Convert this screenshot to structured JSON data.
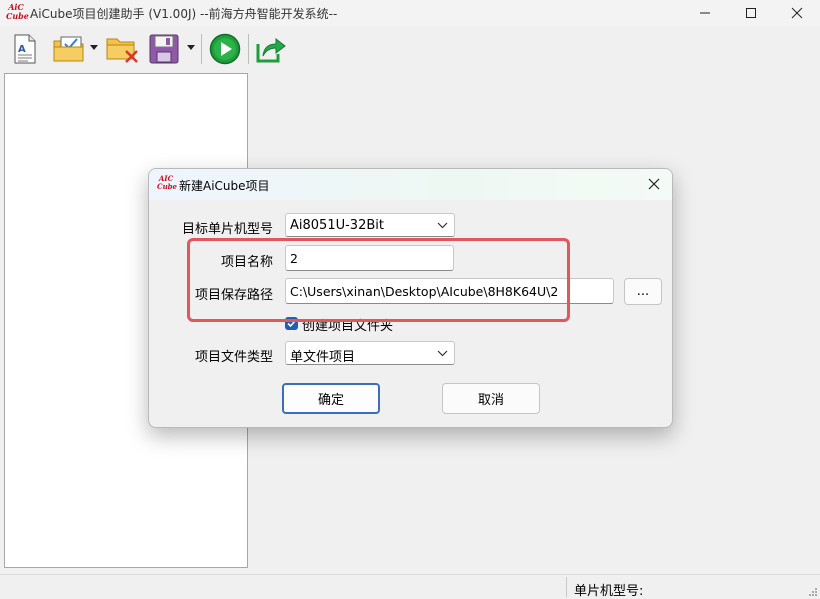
{
  "window": {
    "title": "AiCube项目创建助手 (V1.00J) --前海方舟智能开发系统--",
    "logo_text_top": "AiC",
    "logo_text_bottom": "Cube"
  },
  "toolbar": {
    "icons": [
      "new-file-icon",
      "open-project-icon",
      "close-project-icon",
      "save-icon",
      "run-icon",
      "export-icon"
    ]
  },
  "statusbar": {
    "mcu_model_label": "单片机型号:"
  },
  "dialog": {
    "title": "新建AiCube项目",
    "logo_text_top": "AIC",
    "logo_text_bottom": "Cube",
    "mcu_label": "目标单片机型号",
    "mcu_value": "Ai8051U-32Bit",
    "name_label": "项目名称",
    "name_value": "2",
    "path_label": "项目保存路径",
    "path_value": "C:\\Users\\xinan\\Desktop\\AIcube\\8H8K64U\\2",
    "browse_label": "...",
    "create_folder_label": "创建项目文件夹",
    "create_folder_checked": true,
    "type_label": "项目文件类型",
    "type_value": "单文件项目",
    "ok_label": "确定",
    "cancel_label": "取消"
  },
  "colors": {
    "highlight_box": "#e0575e",
    "accent": "#1f5fb4"
  }
}
